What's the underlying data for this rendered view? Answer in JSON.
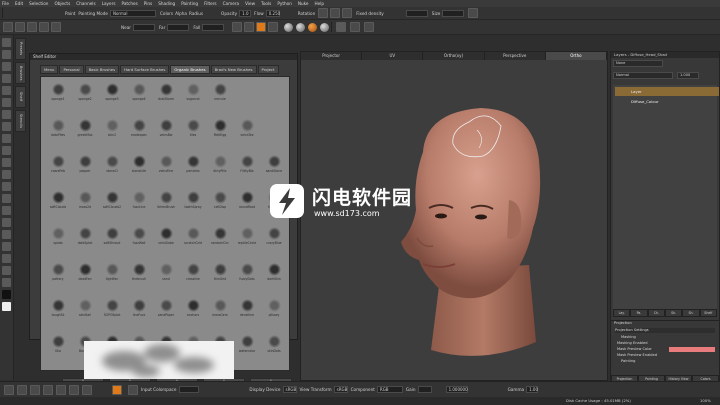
{
  "menubar": [
    "File",
    "Edit",
    "Selection",
    "Objects",
    "Channels",
    "Layers",
    "Patches",
    "Pins",
    "Shading",
    "Painting",
    "Filters",
    "Camera",
    "View",
    "Tools",
    "Python",
    "Nuke",
    "Help"
  ],
  "toolbar1": {
    "paint_label": "Paint",
    "painting_mode_label": "Painting Mode",
    "painting_mode_value": "Normal",
    "colors_label": "Colors",
    "alpha_label": "Alpha",
    "radius_label": "Radius",
    "opacity_label": "Opacity",
    "opacity_value": "1.0",
    "flow_label": "Flow",
    "flow_value": "0.250",
    "rotation_label": "Rotation",
    "fixed_density_label": "Fixed density",
    "size_label": "Size"
  },
  "toolbar2": {
    "near_label": "Near",
    "far_label": "Far",
    "fall_label": "Fall"
  },
  "shelf": {
    "title": "Shelf Editor",
    "tabs": [
      "Menu",
      "Personal",
      "Basic Brushes",
      "Hard Surface Brushes",
      "Organic Brushes",
      "Brad's New Brushes",
      "Project"
    ],
    "active_tab": "Organic Brushes",
    "brushes": [
      [
        "sponge1",
        "sponge2",
        "sponge3",
        "sponge4",
        "dustStorm",
        "sugarcol",
        "nercule"
      ],
      [
        "dataPiles",
        "greekMos",
        "skin2",
        "erodespec",
        "veinsBw",
        "tiles",
        "MeltEgg",
        "veinsTex"
      ],
      [
        "coarsPeb",
        "pepper",
        "stoneCl",
        "stoneLife",
        "veinsFine",
        "particles",
        "dirtyPills",
        "FilthyBlo",
        "sandStone"
      ],
      [
        "softClouds",
        "moss2d",
        "softClouds2",
        "fuzzLine",
        "lichenBrush",
        "toothSpray",
        "cellDisp",
        "roundRoot",
        "hibiscus"
      ],
      [
        "splats",
        "dotsSplat",
        "softShroud",
        "fuzzWall",
        "veinGlobe",
        "scratchGrid",
        "randomCirc",
        "reptileCircle",
        "crazyBlue"
      ],
      [
        "pattery",
        "deadFan",
        "tightFan",
        "thebrush",
        "sand",
        "crossline",
        "thinGrid",
        "fuzzyDots",
        "darkSkin"
      ],
      [
        "toughSk",
        "skinBall",
        "SOPOSplat",
        "lineFuzz",
        "sandPaper",
        "anchors",
        "mossGem",
        "densitive",
        "pillowy"
      ],
      [
        "Glio",
        "Bouzzle",
        "fingerprint",
        "hairscratch",
        "powder",
        "AKStrokes",
        "spacStuff",
        "watercolor",
        "skinDots"
      ]
    ],
    "add_buttons": [
      "+",
      "+",
      "+",
      "+",
      "+"
    ]
  },
  "viewport": {
    "tabs": [
      "Projector",
      "UV",
      "Ortho(xy)",
      "Perspective",
      "Ortho"
    ],
    "active_tab": "Ortho"
  },
  "watermark": {
    "name": "闪电软件园",
    "url": "www.sd173.com"
  },
  "layers": {
    "title": "Layers - Diffuse_Head_Shad",
    "filter_value": "None",
    "blend_value": "Normal",
    "opacity_value": "1.000",
    "items": [
      "Layer",
      "Diffuse_Colour"
    ],
    "tabs": [
      "Lay.",
      "Pa.",
      "Ch.",
      "Sh.",
      "Sh.",
      "Shelf"
    ]
  },
  "projection": {
    "title": "Projection",
    "settings_label": "Projection Settings",
    "rows": [
      "Masking",
      "Masking Enabled",
      "Mask Preview Color",
      "Mask Preview Enabled",
      "Painting"
    ],
    "tabs": [
      "Projection",
      "Painting",
      "History View",
      "Colors"
    ]
  },
  "statusbar": {
    "input_colorspace_label": "Input Colorspace",
    "display_device_label": "Display Device",
    "display_device_value": "sRGB",
    "view_transform_label": "View Transform",
    "view_transform_value": "sRGB",
    "component_label": "Component",
    "component_value": "RGB",
    "gain_label": "Gain",
    "gain_value": "1.000000",
    "gamma_label": "Gamma",
    "gamma_value": "1.00"
  },
  "bottom_status": {
    "disk_cache": "Disk Cache Usage : 45.01MB (2%)",
    "percent": "100%"
  },
  "colors": {
    "mask_preview_color": "#e87c7c",
    "accent_orange": "#e07a18",
    "active_layer": "#8a6a35"
  }
}
